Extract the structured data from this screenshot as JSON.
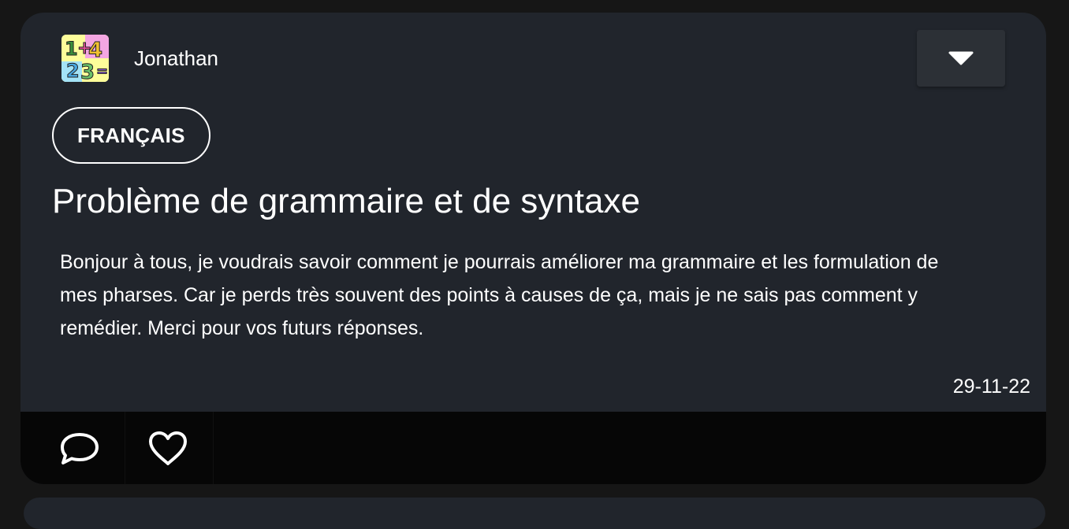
{
  "post": {
    "author": "Jonathan",
    "avatar_icon": "colorful-numbers-avatar",
    "menu_icon": "caret-down-icon",
    "tag": "FRANÇAIS",
    "title": "Problème de grammaire et de syntaxe",
    "body": "Bonjour à tous, je voudrais savoir comment je pourrais améliorer ma grammaire et les formulation de mes pharses. Car je perds très souvent des points à causes de ça, mais je ne sais pas comment y remédier. Merci pour vos futurs réponses.",
    "date": "29-11-22",
    "actions": [
      {
        "icon": "comment-icon"
      },
      {
        "icon": "heart-icon"
      }
    ]
  },
  "colors": {
    "background": "#161616",
    "card": "#21252c",
    "footer": "#060606",
    "menu_button": "#2c3036",
    "text": "#ffffff"
  }
}
